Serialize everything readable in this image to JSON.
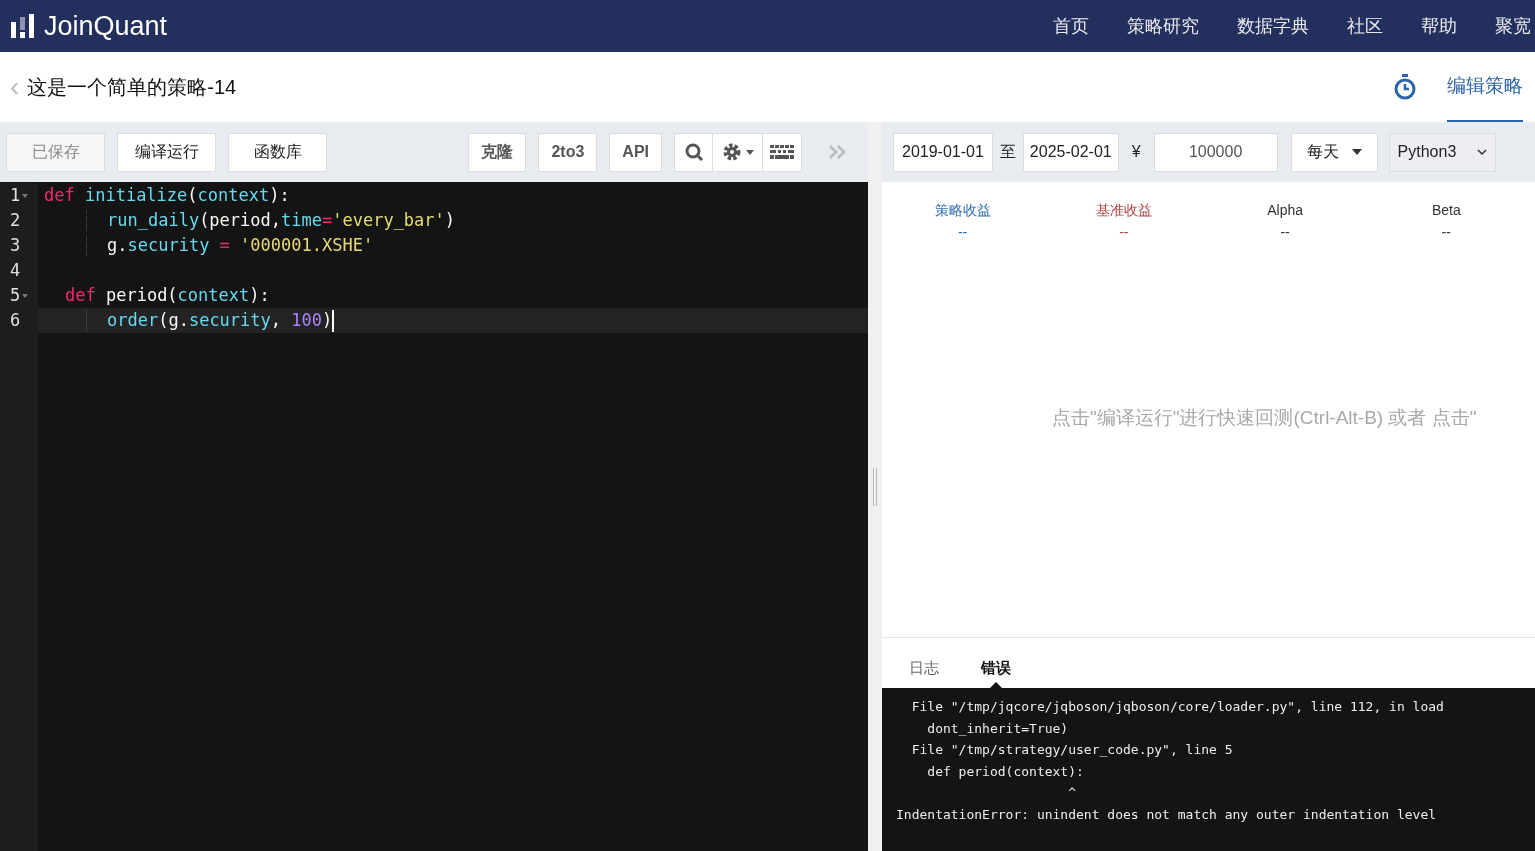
{
  "header": {
    "logo": "JoinQuant",
    "nav": [
      {
        "label": "首页"
      },
      {
        "label": "策略研究"
      },
      {
        "label": "数据字典"
      },
      {
        "label": "社区"
      },
      {
        "label": "帮助"
      },
      {
        "label": "聚宽"
      }
    ]
  },
  "title_bar": {
    "back": "‹",
    "title": "这是一个简单的策略-14",
    "tab": {
      "label": "编辑策略",
      "selected": true
    }
  },
  "toolbar": {
    "left": [
      {
        "label": "已保存",
        "disabled": true
      },
      {
        "label": "编译运行",
        "disabled": false
      },
      {
        "label": "函数库",
        "disabled": false
      }
    ],
    "right": [
      "克隆",
      "2to3",
      "API"
    ]
  },
  "editor": {
    "lines": [
      {
        "number": "1",
        "foldable": true,
        "kind": "flush",
        "active": false,
        "tokens": [
          {
            "kind": "keyword",
            "text": "def "
          },
          {
            "kind": "func",
            "text": "initialize"
          },
          {
            "kind": "plain",
            "text": "("
          },
          {
            "kind": "param",
            "text": "context"
          },
          {
            "kind": "plain",
            "text": "):"
          }
        ]
      },
      {
        "number": "2",
        "foldable": false,
        "kind": "indented",
        "active": false,
        "tokens": [
          {
            "kind": "func",
            "text": "run_daily"
          },
          {
            "kind": "plain",
            "text": "(period,"
          },
          {
            "kind": "param",
            "text": "time"
          },
          {
            "kind": "keyword",
            "text": "="
          },
          {
            "kind": "string",
            "text": "'every_bar'"
          },
          {
            "kind": "plain",
            "text": ")"
          }
        ]
      },
      {
        "number": "3",
        "foldable": false,
        "kind": "indented",
        "active": false,
        "tokens": [
          {
            "kind": "plain",
            "text": "g."
          },
          {
            "kind": "param",
            "text": "security"
          },
          {
            "kind": "keyword",
            "text": " = "
          },
          {
            "kind": "string",
            "text": "'000001.XSHE'"
          }
        ]
      },
      {
        "number": "4",
        "foldable": false,
        "kind": "flush",
        "active": false
      },
      {
        "number": "5",
        "foldable": true,
        "kind": "misindented",
        "active": false,
        "tokens": [
          {
            "kind": "keyword",
            "text": "def "
          },
          {
            "kind": "plain",
            "text": "period("
          },
          {
            "kind": "param",
            "text": "context"
          },
          {
            "kind": "plain",
            "text": "):"
          }
        ]
      },
      {
        "number": "6",
        "foldable": false,
        "kind": "indented",
        "active": true,
        "tokens": [
          {
            "kind": "func",
            "text": "order"
          },
          {
            "kind": "plain",
            "text": "(g."
          },
          {
            "kind": "param",
            "text": "security"
          },
          {
            "kind": "plain",
            "text": ", "
          },
          {
            "kind": "number",
            "text": "100"
          },
          {
            "kind": "plain",
            "text": ")"
          }
        ]
      }
    ]
  },
  "settings": {
    "start_date": "2019-01-01",
    "to": "至",
    "end_date": "2025-02-01",
    "currency": "¥",
    "capital": "100000",
    "frequency": "每天",
    "python": "Python3"
  },
  "stats": [
    {
      "label": "策略收益",
      "value": "--",
      "color": "#2d6bb3"
    },
    {
      "label": "基准收益",
      "value": "--",
      "color": "#a94442"
    },
    {
      "label": "Alpha",
      "value": "--",
      "color": "#333333"
    },
    {
      "label": "Beta",
      "value": "--",
      "color": "#333333"
    }
  ],
  "hint": "点击\"编译运行\"进行快速回测(Ctrl-Alt-B) 或者 点击\"",
  "log_tabs": [
    {
      "label": "日志",
      "selected": false
    },
    {
      "label": "错误",
      "selected": true
    }
  ],
  "log": [
    "  File \"/tmp/jqcore/jqboson/jqboson/core/loader.py\", line 112, in load",
    "    dont_inherit=True)",
    "  File \"/tmp/strategy/user_code.py\", line 5",
    "    def period(context):",
    "                      ^",
    "IndentationError: unindent does not match any outer indentation level"
  ]
}
